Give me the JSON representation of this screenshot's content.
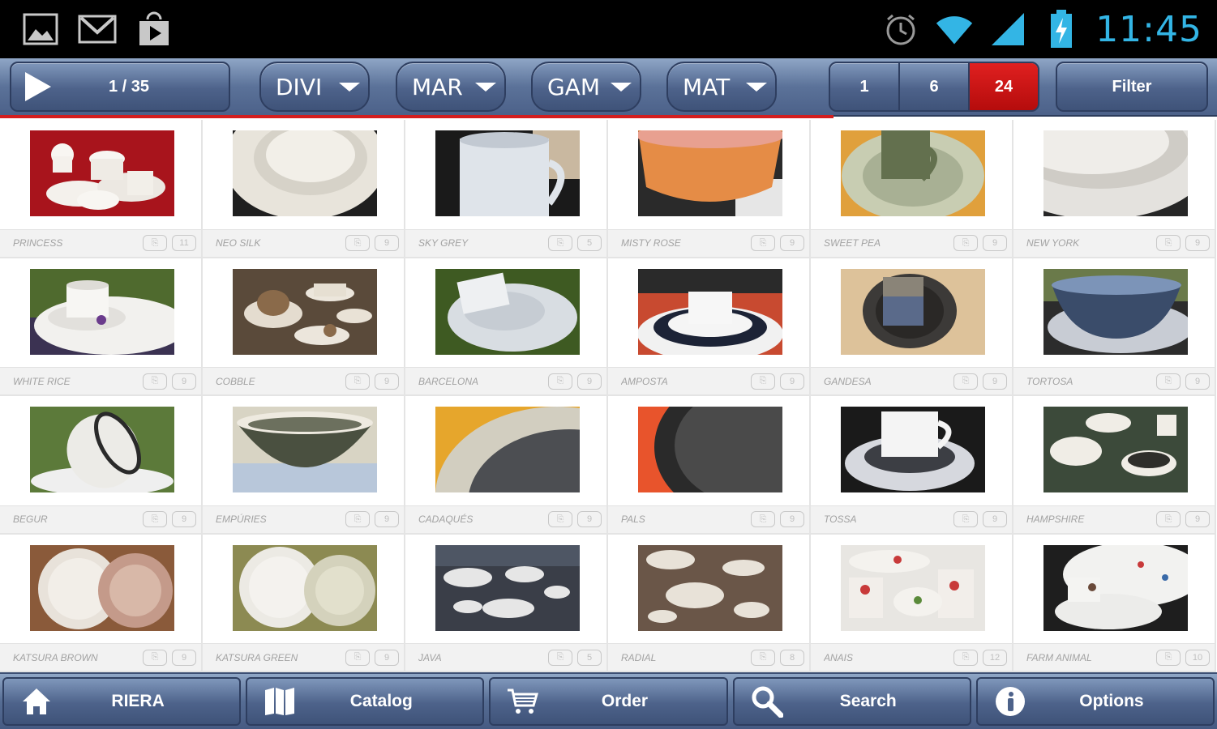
{
  "status_bar": {
    "notification_icons": [
      "gallery-icon",
      "gmail-icon",
      "play-store-icon"
    ],
    "system_icons": [
      "alarm-icon",
      "wifi-icon",
      "signal-icon",
      "battery-charging-icon"
    ],
    "time": "11:45",
    "time_color": "#33b5e5"
  },
  "toolbar": {
    "play_icon": "play-icon",
    "page_indicator": "1 / 35",
    "dropdowns": [
      {
        "label": "DIVI"
      },
      {
        "label": "MAR"
      },
      {
        "label": "GAM"
      },
      {
        "label": "MAT"
      }
    ],
    "per_page_options": [
      "1",
      "6",
      "24"
    ],
    "per_page_selected": "24",
    "filter_label": "Filter",
    "accent_color": "#d41e1e"
  },
  "products": [
    {
      "name": "PRINCESS",
      "b1": "⎘",
      "b2": "11"
    },
    {
      "name": "NEO SILK",
      "b1": "⎘",
      "b2": "9"
    },
    {
      "name": "SKY GREY",
      "b1": "⎘",
      "b2": "5"
    },
    {
      "name": "MISTY ROSE",
      "b1": "⎘",
      "b2": "9"
    },
    {
      "name": "SWEET PEA",
      "b1": "⎘",
      "b2": "9"
    },
    {
      "name": "NEW YORK",
      "b1": "⎘",
      "b2": "9"
    },
    {
      "name": "WHITE RICE",
      "b1": "⎘",
      "b2": "9"
    },
    {
      "name": "COBBLE",
      "b1": "⎘",
      "b2": "9"
    },
    {
      "name": "BARCELONA",
      "b1": "⎘",
      "b2": "9"
    },
    {
      "name": "AMPOSTA",
      "b1": "⎘",
      "b2": "9"
    },
    {
      "name": "GANDESA",
      "b1": "⎘",
      "b2": "9"
    },
    {
      "name": "TORTOSA",
      "b1": "⎘",
      "b2": "9"
    },
    {
      "name": "BEGUR",
      "b1": "⎘",
      "b2": "9"
    },
    {
      "name": "EMPÚRIES",
      "b1": "⎘",
      "b2": "9"
    },
    {
      "name": "CADAQUÉS",
      "b1": "⎘",
      "b2": "9"
    },
    {
      "name": "PALS",
      "b1": "⎘",
      "b2": "9"
    },
    {
      "name": "TOSSA",
      "b1": "⎘",
      "b2": "9"
    },
    {
      "name": "HAMPSHIRE",
      "b1": "⎘",
      "b2": "9"
    },
    {
      "name": "KATSURA BROWN",
      "b1": "⎘",
      "b2": "9"
    },
    {
      "name": "KATSURA GREEN",
      "b1": "⎘",
      "b2": "9"
    },
    {
      "name": "JAVA",
      "b1": "⎘",
      "b2": "5"
    },
    {
      "name": "RADIAL",
      "b1": "⎘",
      "b2": "8"
    },
    {
      "name": "ANAIS",
      "b1": "⎘",
      "b2": "12"
    },
    {
      "name": "FARM ANIMAL",
      "b1": "⎘",
      "b2": "10"
    }
  ],
  "bottom_nav": [
    {
      "icon": "home-icon",
      "label": "RIERA"
    },
    {
      "icon": "map-icon",
      "label": "Catalog"
    },
    {
      "icon": "cart-icon",
      "label": "Order"
    },
    {
      "icon": "search-icon",
      "label": "Search"
    },
    {
      "icon": "info-icon",
      "label": "Options"
    }
  ]
}
